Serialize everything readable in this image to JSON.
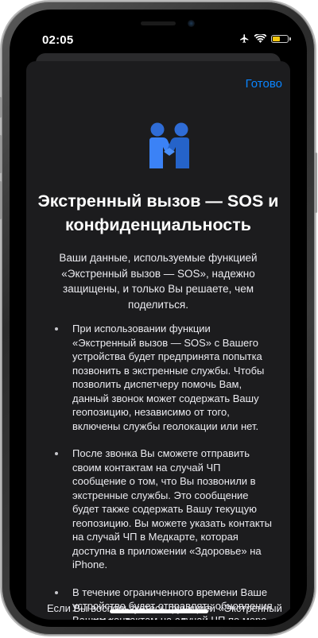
{
  "status_bar": {
    "time": "02:05",
    "icons": [
      "airplane-icon",
      "wifi-icon",
      "battery-icon"
    ],
    "battery_color": "#f2c60f"
  },
  "sheet": {
    "done_label": "Готово",
    "hero_icon": "handshake-people-icon",
    "accent_color": "#0a84ff",
    "title": "Экстренный вызов — SOS и конфиденциальность",
    "subtitle": "Ваши данные, используемые функцией «Экстренный вызов — SOS», надежно защищены, и только Вы решаете, чем поделиться.",
    "bullets": [
      "При использовании функции «Экстренный вызов — SOS» с Вашего устройства будет предпринята попытка позвонить в экстренные службы. Чтобы позволить диспетчеру помочь Вам, данный звонок может содержать Вашу геопозицию, независимо от того, включены службы геолокации или нет.",
      "После звонка Вы сможете отправить своим контактам на случай ЧП сообщение о том, что Вы позвонили в экстренные службы. Это сообщение будет также содержать Вашу текущую геопозицию. Вы можете указать контакты на случай ЧП в Медкарте, которая доступна в приложении «Здоровье» на iPhone.",
      "В течение ограниченного времени Ваше устройство будет отправлять обновления Вашим контактам на случай ЧП по мере изменения Вашей геопозиции."
    ],
    "footer": "Если Вы воспользуетесь функцией «Экстренный вызов — SOS», Ваше устройство попытается отправить вызов в экстренные службы. Чтобы"
  }
}
